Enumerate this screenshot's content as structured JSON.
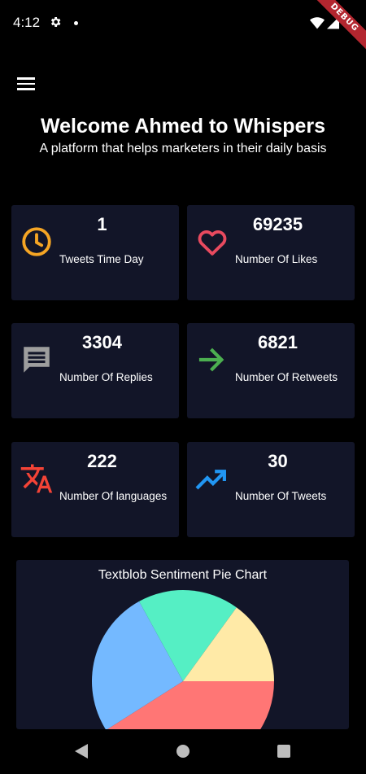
{
  "status_bar": {
    "time": "4:12",
    "debug_label": "DEBUG"
  },
  "header": {
    "title": "Welcome Ahmed to Whispers",
    "subtitle": "A platform that helps marketers in their daily basis"
  },
  "stats": [
    {
      "value": "1",
      "label": "Tweets Time Day",
      "icon": "clock-icon",
      "color": "#f5a524"
    },
    {
      "value": "69235",
      "label": "Number Of Likes",
      "icon": "heart-icon",
      "color": "#e84a5f"
    },
    {
      "value": "3304",
      "label": "Number Of Replies",
      "icon": "comment-icon",
      "color": "#9e9e9e"
    },
    {
      "value": "6821",
      "label": "Number Of Retweets",
      "icon": "arrow-right-icon",
      "color": "#4caf50"
    },
    {
      "value": "222",
      "label": "Number Of languages",
      "icon": "translate-icon",
      "color": "#f44336"
    },
    {
      "value": "30",
      "label": "Number Of Tweets",
      "icon": "trending-up-icon",
      "color": "#2196f3"
    }
  ],
  "chart_data": {
    "type": "pie",
    "title": "Textblob Sentiment Pie Chart",
    "categories": [
      "",
      "",
      "",
      ""
    ],
    "values": [
      41,
      26,
      18,
      15
    ],
    "colors": [
      "#ff7675",
      "#74b9ff",
      "#55efc4",
      "#ffeaa7"
    ]
  }
}
